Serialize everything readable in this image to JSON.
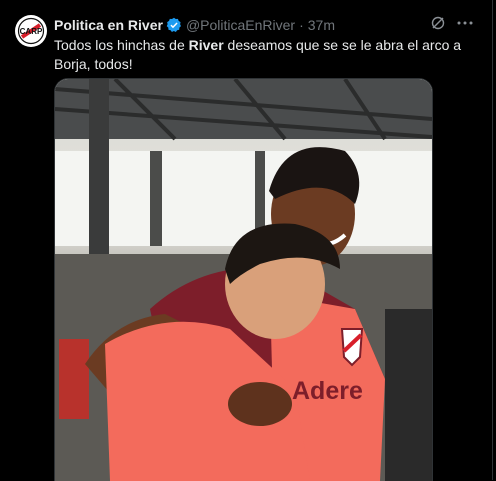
{
  "tweet": {
    "author_name": "Politica en River",
    "handle": "@PoliticaEnRiver",
    "separator": "·",
    "time": "37m",
    "text_before": "Todos los hinchas de ",
    "text_bold": "River",
    "text_after": " deseamos que se se le abra el arco a Borja, todos!",
    "verified_color": "#1d9bf0",
    "media_sponsor_text": "Adere"
  },
  "icons": {
    "verified": "verified-badge-icon",
    "grok": "grok-icon",
    "more": "more-icon"
  },
  "colors": {
    "background": "#000000",
    "text": "#e7e9ea",
    "muted": "#71767b",
    "river_red": "#d81e2a",
    "kit_salmon": "#f36b5c",
    "kit_maroon": "#7d1e2a"
  }
}
